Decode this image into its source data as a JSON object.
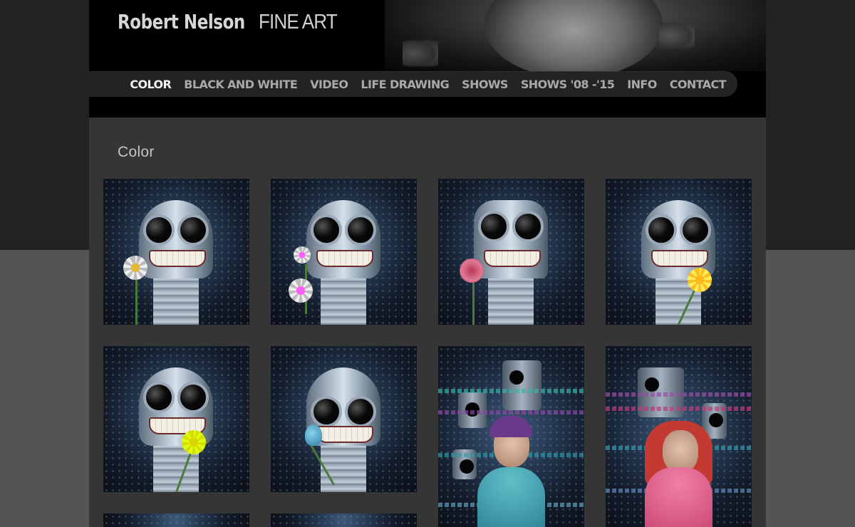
{
  "site": {
    "logo_name": "Robert Nelson",
    "logo_sub": "FINE ART"
  },
  "nav": {
    "items": [
      {
        "label": "COLOR",
        "active": true
      },
      {
        "label": "BLACK AND WHITE",
        "active": false
      },
      {
        "label": "VIDEO",
        "active": false
      },
      {
        "label": "LIFE DRAWING",
        "active": false
      },
      {
        "label": "SHOWS",
        "active": false
      },
      {
        "label": "SHOWS '08 -'15",
        "active": false
      },
      {
        "label": "INFO",
        "active": false
      },
      {
        "label": "CONTACT",
        "active": false
      }
    ]
  },
  "page": {
    "title": "Color"
  },
  "gallery": {
    "items": [
      {
        "type": "robot",
        "flower": "white daisy"
      },
      {
        "type": "robot",
        "flower": "purple asters"
      },
      {
        "type": "robot",
        "flower": "pink rose"
      },
      {
        "type": "robot",
        "flower": "orange daisy"
      },
      {
        "type": "robot",
        "flower": "yellow daisy"
      },
      {
        "type": "robot",
        "flower": "blue tulip"
      },
      {
        "type": "girl-with-robots",
        "dress": "teal"
      },
      {
        "type": "girl-with-robots",
        "dress": "pink"
      },
      {
        "type": "partial"
      },
      {
        "type": "partial"
      }
    ]
  },
  "colors": {
    "page_top": "#232323",
    "page_bottom": "#545454",
    "content_bg": "#353535",
    "header_bg": "#000000",
    "nav_text": "#a9a9a9",
    "nav_active": "#f2f2f2"
  }
}
